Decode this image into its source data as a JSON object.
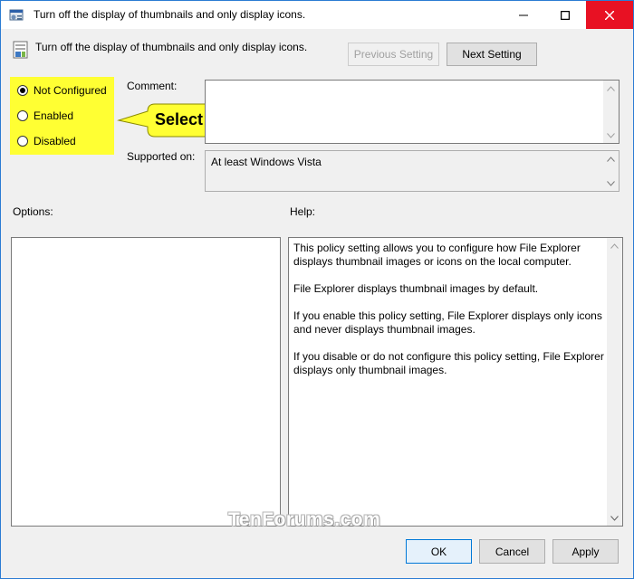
{
  "window": {
    "title": "Turn off the display of thumbnails and only display icons.",
    "controls": {
      "minimize": "minimize",
      "maximize": "maximize",
      "close": "close"
    }
  },
  "header": {
    "setting_name": "Turn off the display of thumbnails and only display icons.",
    "previous_setting_label": "Previous Setting",
    "next_setting_label": "Next Setting"
  },
  "state": {
    "options": [
      {
        "label": "Not Configured",
        "selected": true
      },
      {
        "label": "Enabled",
        "selected": false
      },
      {
        "label": "Disabled",
        "selected": false
      }
    ]
  },
  "callout": {
    "text": "Select",
    "color": "#ffff33"
  },
  "comment": {
    "label": "Comment:",
    "value": ""
  },
  "supported_on": {
    "label": "Supported on:",
    "value": "At least Windows Vista"
  },
  "options_panel": {
    "label": "Options:"
  },
  "help_panel": {
    "label": "Help:",
    "paragraphs": [
      "This policy setting allows you to configure how File Explorer displays thumbnail images or icons on the local computer.",
      "File Explorer displays thumbnail images by default.",
      "If you enable this policy setting, File Explorer displays only icons and never displays thumbnail images.",
      "If you disable or do not configure this policy setting, File Explorer displays only thumbnail images."
    ]
  },
  "footer": {
    "ok_label": "OK",
    "cancel_label": "Cancel",
    "apply_label": "Apply"
  },
  "watermark": "TenForums.com",
  "colors": {
    "accent": "#0078d7",
    "close_red": "#e81123",
    "highlight": "#ffff33"
  }
}
